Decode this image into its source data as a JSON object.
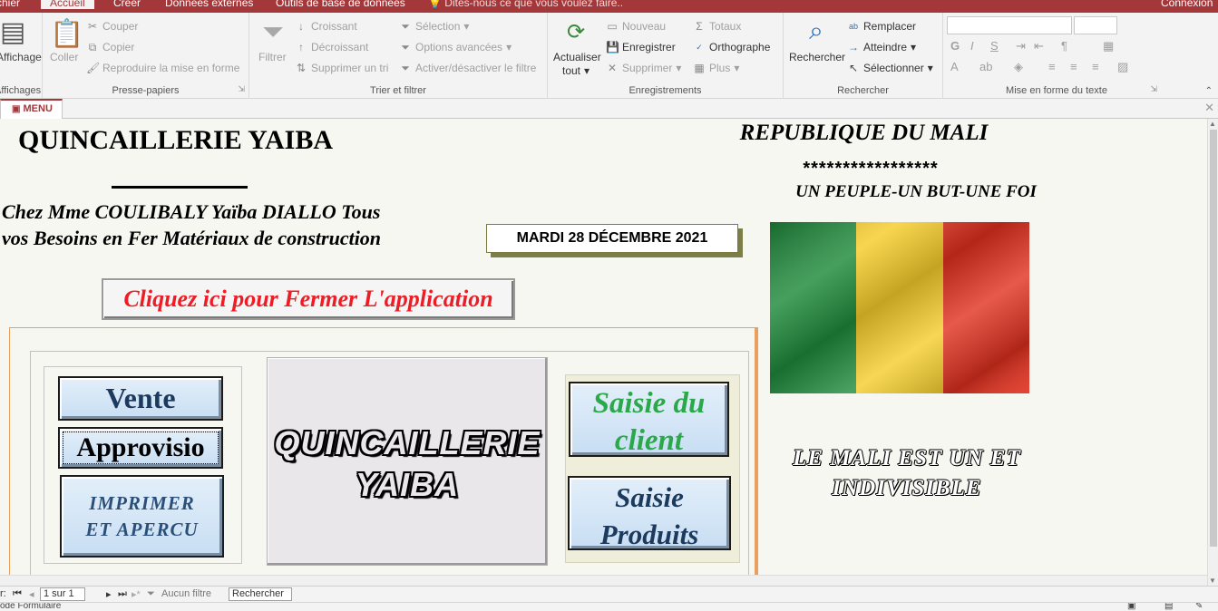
{
  "app": {
    "tabs": [
      "Fichier",
      "Accueil",
      "Créer",
      "Données externes",
      "Outils de base de données"
    ],
    "active_tab": "Accueil",
    "tell_me": "Dites-nous ce que vous voulez faire..",
    "account": "Connexion"
  },
  "ribbon": {
    "affichages": {
      "button": "Affichage",
      "label": "Affichages"
    },
    "clipboard": {
      "paste": "Coller",
      "cut": "Couper",
      "copy": "Copier",
      "format_painter": "Reproduire la mise en forme",
      "label": "Presse-papiers"
    },
    "sort_filter": {
      "filter": "Filtrer",
      "ascending": "Croissant",
      "descending": "Décroissant",
      "remove_sort": "Supprimer un tri",
      "selection": "Sélection",
      "advanced": "Options avancées",
      "toggle_filter": "Activer/désactiver le filtre",
      "label": "Trier et filtrer"
    },
    "records": {
      "refresh_all": "Actualiser",
      "refresh_all_2": "tout",
      "new": "Nouveau",
      "save": "Enregistrer",
      "delete": "Supprimer",
      "totals": "Totaux",
      "spelling": "Orthographe",
      "more": "Plus",
      "label": "Enregistrements"
    },
    "find": {
      "find": "Rechercher",
      "replace": "Remplacer",
      "goto": "Atteindre",
      "select": "Sélectionner",
      "label": "Rechercher"
    },
    "text_formatting": {
      "bold": "G",
      "italic": "I",
      "underline": "S",
      "font_color": "A",
      "label": "Mise en forme du texte"
    }
  },
  "document_tab": {
    "label": "MENU"
  },
  "form": {
    "shop_title": "QUINCAILLERIE YAIBA",
    "subtitle_line1": "Chez Mme COULIBALY Yaïba DIALLO Tous",
    "subtitle_line2": "vos Besoins en Fer Matériaux de construction",
    "date": "MARDI 28 DÉCEMBRE 2021",
    "close_button": "Cliquez ici pour Fermer L'application",
    "republic": "REPUBLIQUE DU MALI",
    "stars": "*****************",
    "motto": "UN PEUPLE-UN BUT-UNE FOI",
    "indivisible_line1": "LE MALI EST UN ET",
    "indivisible_line2": "INDIVISIBLE",
    "center_title_line1": "QUINCAILLERIE",
    "center_title_line2": "YAIBA",
    "buttons": {
      "vente": "Vente",
      "approvisio": "Approvisio",
      "print_line1": "IMPRIMER",
      "print_line2": "ET APERCU",
      "client_line1": "Saisie du",
      "client_line2": "client",
      "produits_line1": "Saisie",
      "produits_line2": "Produits"
    },
    "flag_colors": [
      "#1e8a3a",
      "#f5cc2a",
      "#e0301e"
    ]
  },
  "navigation": {
    "label": "r:",
    "position": "1 sur 1",
    "filter": "Aucun filtre",
    "search": "Rechercher"
  },
  "status": {
    "text": "ode Formulaire"
  }
}
